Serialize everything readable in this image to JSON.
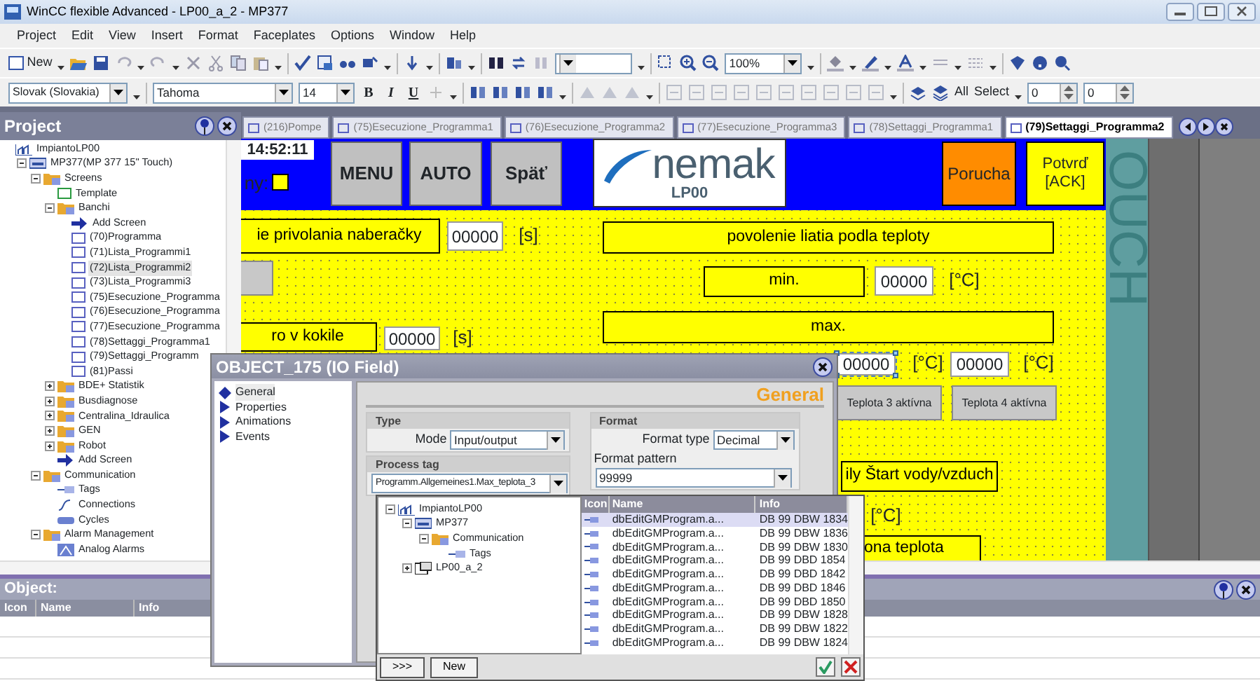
{
  "window": {
    "title": "WinCC flexible Advanced - LP00_a_2 - MP377"
  },
  "menu": [
    "Project",
    "Edit",
    "View",
    "Insert",
    "Format",
    "Faceplates",
    "Options",
    "Window",
    "Help"
  ],
  "toolbar": {
    "new_label": "New",
    "zoom": "100%",
    "language": "Slovak (Slovakia)",
    "font": "Tahoma",
    "font_size": "14",
    "format_buttons": [
      "B",
      "I",
      "U"
    ],
    "all_label": "All",
    "select_label": "Select",
    "spin_1": "0",
    "spin_2": "0"
  },
  "project_panel": {
    "title": "Project",
    "tree": [
      {
        "label": "ImpiantoLP00",
        "kind": "plant",
        "children": [
          {
            "label": "MP377(MP 377 15\" Touch)",
            "kind": "device",
            "expanded": true,
            "children": [
              {
                "label": "Screens",
                "kind": "folder",
                "expanded": true,
                "children": [
                  {
                    "label": "Template",
                    "kind": "template"
                  },
                  {
                    "label": "Banchi",
                    "kind": "folder",
                    "expanded": true,
                    "children": [
                      {
                        "label": "Add Screen",
                        "kind": "add",
                        "selected": false
                      },
                      {
                        "label": "(70)Programma",
                        "kind": "screen",
                        "selected": false
                      },
                      {
                        "label": "(71)Lista_Programmi1",
                        "kind": "screen",
                        "selected": false
                      },
                      {
                        "label": "(72)Lista_Programmi2",
                        "kind": "screen",
                        "selected": true
                      },
                      {
                        "label": "(73)Lista_Programmi3",
                        "kind": "screen",
                        "selected": false
                      },
                      {
                        "label": "(75)Esecuzione_Programma",
                        "kind": "screen",
                        "selected": false
                      },
                      {
                        "label": "(76)Esecuzione_Programma",
                        "kind": "screen",
                        "selected": false
                      },
                      {
                        "label": "(77)Esecuzione_Programma",
                        "kind": "screen",
                        "selected": false
                      },
                      {
                        "label": "(78)Settaggi_Programma1",
                        "kind": "screen",
                        "selected": false
                      },
                      {
                        "label": "(79)Settaggi_Programm",
                        "kind": "screen",
                        "selected": false
                      },
                      {
                        "label": "(81)Passi",
                        "kind": "screen",
                        "selected": false
                      }
                    ]
                  },
                  {
                    "label": "BDE+ Statistik",
                    "kind": "folder",
                    "expanded": false
                  },
                  {
                    "label": "Busdiagnose",
                    "kind": "folder",
                    "expanded": false
                  },
                  {
                    "label": "Centralina_Idraulica",
                    "kind": "folder",
                    "expanded": false
                  },
                  {
                    "label": "GEN",
                    "kind": "folder",
                    "expanded": false
                  },
                  {
                    "label": "Robot",
                    "kind": "folder",
                    "expanded": false
                  },
                  {
                    "label": "Add Screen",
                    "kind": "add"
                  }
                ]
              },
              {
                "label": "Communication",
                "kind": "folder",
                "expanded": true,
                "children": [
                  {
                    "label": "Tags",
                    "kind": "tags"
                  },
                  {
                    "label": "Connections",
                    "kind": "connections"
                  },
                  {
                    "label": "Cycles",
                    "kind": "cycles"
                  }
                ]
              },
              {
                "label": "Alarm Management",
                "kind": "folder",
                "expanded": true,
                "children": [
                  {
                    "label": "Analog Alarms",
                    "kind": "alarm"
                  }
                ]
              }
            ]
          }
        ]
      }
    ]
  },
  "tabs": [
    {
      "label": "(216)Pompe",
      "selected": false
    },
    {
      "label": "(75)Esecuzione_Programma1",
      "selected": false
    },
    {
      "label": "(76)Esecuzione_Programma2",
      "selected": false
    },
    {
      "label": "(77)Esecuzione_Programma3",
      "selected": false
    },
    {
      "label": "(78)Settaggi_Programma1",
      "selected": false
    },
    {
      "label": "(79)Settaggi_Programma2",
      "selected": true
    }
  ],
  "hmi_screen": {
    "side_text": "OUCH",
    "items": [
      {
        "kind": "clock",
        "text": "14:52:11"
      },
      {
        "kind": "text",
        "text": "ny:"
      },
      {
        "kind": "indicator"
      },
      {
        "kind": "header-button",
        "text": "MENU"
      },
      {
        "kind": "header-button",
        "text": "AUTO"
      },
      {
        "kind": "header-button",
        "text": "Späť"
      },
      {
        "kind": "logo",
        "text": "nemak",
        "subtext": "LP00"
      },
      {
        "kind": "alarm-button",
        "text": "Porucha"
      },
      {
        "kind": "ack-button",
        "text": "Potvrď [ACK]"
      },
      {
        "kind": "label",
        "text": "ie privolania naberačky"
      },
      {
        "kind": "field",
        "text": "00000",
        "selected": false
      },
      {
        "kind": "text",
        "text": "[s]"
      },
      {
        "kind": "button"
      },
      {
        "kind": "label",
        "text": "povolenie liatia podla teploty"
      },
      {
        "kind": "label",
        "text": "min."
      },
      {
        "kind": "field",
        "text": "00000",
        "selected": false
      },
      {
        "kind": "text",
        "text": "[°C]"
      },
      {
        "kind": "label",
        "text": "max."
      },
      {
        "kind": "label",
        "text": "ro v kokile"
      },
      {
        "kind": "field",
        "text": "00000",
        "selected": false
      },
      {
        "kind": "text",
        "text": "[s]"
      },
      {
        "kind": "field",
        "text": "00000",
        "selected": true
      },
      {
        "kind": "text",
        "text": "[°C]"
      },
      {
        "kind": "field",
        "text": "00000",
        "selected": false
      },
      {
        "kind": "text",
        "text": "[°C]"
      },
      {
        "kind": "button",
        "text": "Teplota 3 aktívna"
      },
      {
        "kind": "button",
        "text": "Teplota 4 aktívna"
      },
      {
        "kind": "label",
        "text": "ily Štart vody/vzduch"
      },
      {
        "kind": "text",
        "text": "[°C]"
      },
      {
        "kind": "label",
        "text": "ona teplota"
      }
    ]
  },
  "dialog": {
    "title": "OBJECT_175 (IO Field)",
    "nav": [
      {
        "label": "General",
        "selected": true
      },
      {
        "label": "Properties",
        "selected": false
      },
      {
        "label": "Animations",
        "selected": false
      },
      {
        "label": "Events",
        "selected": false
      }
    ],
    "heading": "General",
    "type_group": "Type",
    "mode_label": "Mode",
    "mode": "Input/output",
    "process_group": "Process tag",
    "process_tag": "Programm.Allgemeines1.Max_teplota_3",
    "format_group": "Format",
    "format_type_label": "Format type",
    "format_type": "Decimal",
    "format_pattern_label": "Format pattern",
    "format_pattern": "99999"
  },
  "tag_picker": {
    "tree": [
      {
        "label": "ImpiantoLP00",
        "kind": "plant",
        "expanded": true,
        "children": [
          {
            "label": "MP377",
            "kind": "device",
            "expanded": true,
            "children": [
              {
                "label": "Communication",
                "kind": "folder",
                "expanded": true,
                "children": [
                  {
                    "label": "Tags",
                    "kind": "tags"
                  }
                ]
              }
            ]
          },
          {
            "label": "LP00_a_2",
            "kind": "project",
            "expanded": false
          }
        ]
      }
    ],
    "columns": [
      "Icon",
      "Name",
      "Info"
    ],
    "rows": [
      {
        "name": "dbEditGMProgram.a...",
        "info": "DB 99 DBW 1834",
        "selected": true
      },
      {
        "name": "dbEditGMProgram.a...",
        "info": "DB 99 DBW 1836",
        "selected": false
      },
      {
        "name": "dbEditGMProgram.a...",
        "info": "DB 99 DBW 1830",
        "selected": false
      },
      {
        "name": "dbEditGMProgram.a...",
        "info": "DB 99 DBD 1854",
        "selected": false
      },
      {
        "name": "dbEditGMProgram.a...",
        "info": "DB 99 DBD 1842",
        "selected": false
      },
      {
        "name": "dbEditGMProgram.a...",
        "info": "DB 99 DBD 1846",
        "selected": false
      },
      {
        "name": "dbEditGMProgram.a...",
        "info": "DB 99 DBD 1850",
        "selected": false
      },
      {
        "name": "dbEditGMProgram.a...",
        "info": "DB 99 DBW 1828",
        "selected": false
      },
      {
        "name": "dbEditGMProgram.a...",
        "info": "DB 99 DBW 1822",
        "selected": false
      },
      {
        "name": "dbEditGMProgram.a...",
        "info": "DB 99 DBW 1824",
        "selected": false
      }
    ],
    "more_button": ">>>",
    "new_button": "New"
  },
  "object_panel": {
    "title": "Object:",
    "columns": [
      "Icon",
      "Name",
      "Info"
    ]
  }
}
